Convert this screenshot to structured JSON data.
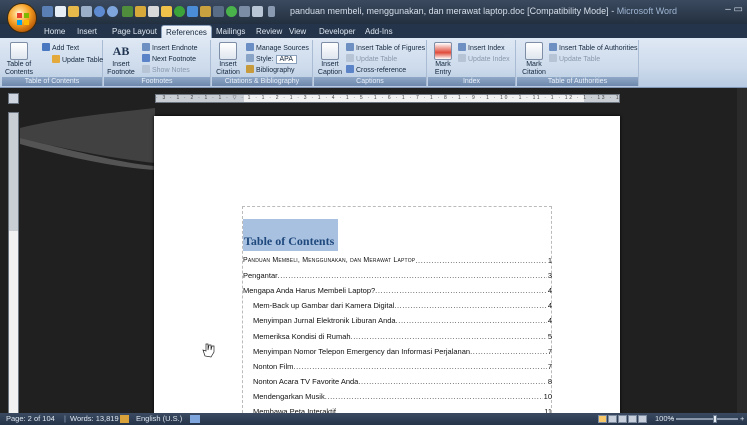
{
  "window": {
    "title_doc": "panduan membeli, menggunakan, dan merawat laptop.doc [Compatibility Mode]",
    "title_sep": " - ",
    "title_app": "Microsoft Word",
    "controls": "– ▭"
  },
  "tabs": [
    "Home",
    "Insert",
    "Page Layout",
    "References",
    "Mailings",
    "Review",
    "View",
    "Developer",
    "Add-Ins"
  ],
  "active_tab": "References",
  "ribbon": {
    "toc": {
      "group_label": "Table of Contents",
      "table_of_contents": "Table of Contents",
      "add_text": "Add Text",
      "update_table": "Update Table"
    },
    "footnotes": {
      "group_label": "Footnotes",
      "insert_footnote": "Insert Footnote",
      "ab_glyph": "AB",
      "insert_endnote": "Insert Endnote",
      "next_footnote": "Next Footnote",
      "show_notes": "Show Notes"
    },
    "citations": {
      "group_label": "Citations & Bibliography",
      "insert_citation": "Insert Citation",
      "manage_sources": "Manage Sources",
      "style_label": "Style:",
      "style_value": "APA",
      "bibliography": "Bibliography"
    },
    "captions": {
      "group_label": "Captions",
      "insert_caption": "Insert Caption",
      "insert_table_of_figures": "Insert Table of Figures",
      "update_table": "Update Table",
      "cross_reference": "Cross-reference"
    },
    "index": {
      "group_label": "Index",
      "mark_entry": "Mark Entry",
      "insert_index": "Insert Index",
      "update_index": "Update Index"
    },
    "authorities": {
      "group_label": "Table of Authorities",
      "mark_citation": "Mark Citation",
      "insert_table_of_authorities": "Insert Table of Authorities",
      "update_table": "Update Table"
    }
  },
  "ruler": {
    "ticks": "· 3 · 1 · 2 · 1 · 1 · ▽ · 1 · 1 · 2 · 1 · 3 · 1 · 4 · 1 · 5 · 1 · 6 · 1 · 7 · 1 · 8 · 1 · 9 · 1 · 10 · 1 · 11 · 1 · 12 · 1 · 13 · 1 · △ · 15 · 1 · 16 · 1 · 17 ·"
  },
  "document": {
    "toc_heading": "Table of Contents",
    "entries": [
      {
        "text": "Panduan Membeli, Menggunakan, dan Merawat Laptop",
        "page": "1",
        "level": 0,
        "smallcaps": true
      },
      {
        "text": "Pengantar",
        "page": "3",
        "level": 0,
        "smallcaps": false
      },
      {
        "text": "Mengapa Anda Harus Membeli Laptop?",
        "page": "4",
        "level": 0,
        "smallcaps": false
      },
      {
        "text": "Mem-Back up Gambar dari Kamera Digital",
        "page": "4",
        "level": 1,
        "smallcaps": false
      },
      {
        "text": "Menyimpan Jurnal Elektronik Liburan Anda",
        "page": "4",
        "level": 1,
        "smallcaps": false
      },
      {
        "text": "Memeriksa Kondisi di Rumah",
        "page": "5",
        "level": 1,
        "smallcaps": false
      },
      {
        "text": "Menyimpan Nomor Telepon Emergency dan Informasi Perjalanan",
        "page": "7",
        "level": 1,
        "smallcaps": false
      },
      {
        "text": "Nonton Film",
        "page": "7",
        "level": 1,
        "smallcaps": false
      },
      {
        "text": "Nonton Acara TV Favorite Anda",
        "page": "8",
        "level": 1,
        "smallcaps": false
      },
      {
        "text": "Mendengarkan Musik",
        "page": "10",
        "level": 1,
        "smallcaps": false
      },
      {
        "text": "Membawa Peta Interaktif",
        "page": "11",
        "level": 1,
        "smallcaps": false
      }
    ]
  },
  "status": {
    "page": "Page: 2 of 104",
    "words": "Words: 13,819",
    "language": "English (U.S.)",
    "zoom": "100%",
    "zoom_minus": "−",
    "zoom_plus": "+"
  },
  "colors": {
    "heading_fill": "#a9c1e0",
    "heading_text": "#1f497d",
    "ribbon": "#cddbec",
    "titlebar": "#22303f"
  }
}
